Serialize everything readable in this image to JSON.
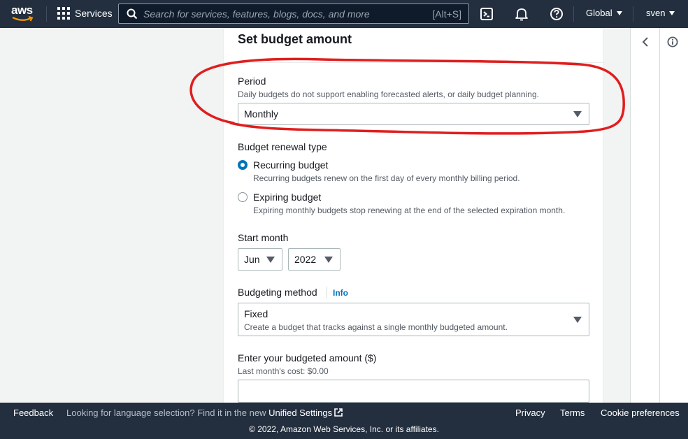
{
  "topnav": {
    "logo_text": "aws",
    "services_label": "Services",
    "search_placeholder": "Search for services, features, blogs, docs, and more",
    "search_shortcut": "[Alt+S]",
    "region_label": "Global",
    "user_label": "sven"
  },
  "card": {
    "title": "Set budget amount",
    "period": {
      "label": "Period",
      "description": "Daily budgets do not support enabling forecasted alerts, or daily budget planning.",
      "value": "Monthly"
    },
    "renewal": {
      "label": "Budget renewal type",
      "options": [
        {
          "label": "Recurring budget",
          "description": "Recurring budgets renew on the first day of every monthly billing period.",
          "selected": true
        },
        {
          "label": "Expiring budget",
          "description": "Expiring monthly budgets stop renewing at the end of the selected expiration month.",
          "selected": false
        }
      ]
    },
    "start_month": {
      "label": "Start month",
      "month": "Jun",
      "year": "2022"
    },
    "budgeting_method": {
      "label": "Budgeting method",
      "info_link": "Info",
      "value": "Fixed",
      "value_description": "Create a budget that tracks against a single monthly budgeted amount."
    },
    "amount": {
      "label": "Enter your budgeted amount ($)",
      "description": "Last month's cost: $0.00",
      "value": ""
    }
  },
  "footer": {
    "feedback": "Feedback",
    "language_prompt": "Looking for language selection? Find it in the new",
    "unified_settings": "Unified Settings",
    "privacy": "Privacy",
    "terms": "Terms",
    "cookie_preferences": "Cookie preferences",
    "copyright": "© 2022, Amazon Web Services, Inc. or its affiliates."
  },
  "colors": {
    "nav_bg": "#232f3e",
    "link": "#0073bb",
    "annotation": "#e01e1e"
  },
  "icons": [
    "aws-smile-icon",
    "services-grid-icon",
    "search-icon",
    "cloudshell-icon",
    "bell-icon",
    "help-icon",
    "chevron-left-icon",
    "info-circle-icon",
    "external-link-icon"
  ]
}
